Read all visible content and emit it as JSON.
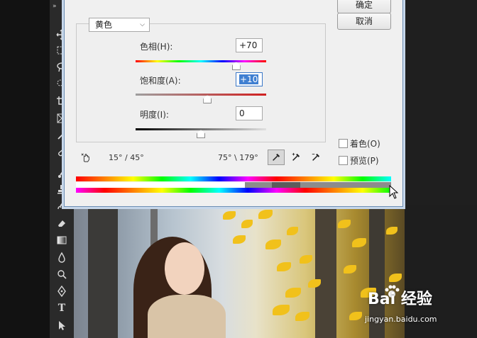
{
  "dialog": {
    "partial_top": "",
    "ok_label": "确定",
    "cancel_label": "取消",
    "channel_selected": "黄色",
    "hue": {
      "label": "色相(H):",
      "value": "+70",
      "thumb_fraction": 0.77
    },
    "saturation": {
      "label": "饱和度(A):",
      "value": "+10",
      "thumb_fraction": 0.55
    },
    "lightness": {
      "label": "明度(I):",
      "value": "0",
      "thumb_fraction": 0.5
    },
    "colorize_label": "着色(O)",
    "preview_label": "预览(P)",
    "left_degrees": "15° / 45°",
    "right_degrees": "75° \\ 179°"
  },
  "watermark": {
    "brand": "Bai 经验",
    "url": "jingyan.baidu.com"
  },
  "colors": {
    "accent": "#3f7fd1",
    "panel": "#f0f0f0",
    "leaf": "#f1c11b"
  }
}
